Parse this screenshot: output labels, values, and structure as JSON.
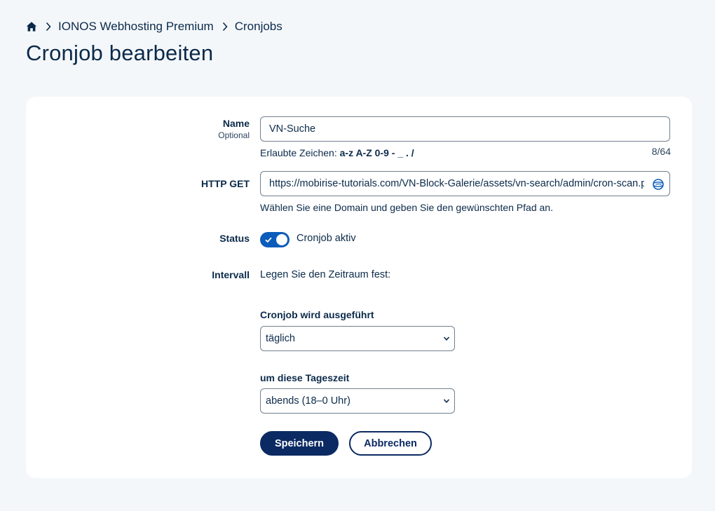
{
  "breadcrumb": {
    "items": [
      "IONOS Webhosting Premium",
      "Cronjobs"
    ]
  },
  "page": {
    "title": "Cronjob bearbeiten"
  },
  "form": {
    "name": {
      "label": "Name",
      "sublabel": "Optional",
      "value": "VN-Suche",
      "help_prefix": "Erlaubte Zeichen:",
      "help_chars": "a-z A-Z 0-9 - _ . /",
      "counter": "8/64"
    },
    "http_get": {
      "label": "HTTP GET",
      "value": "https://mobirise-tutorials.com/VN-Block-Galerie/assets/vn-search/admin/cron-scan.php",
      "help": "Wählen Sie eine Domain und geben Sie den gewünschten Pfad an."
    },
    "status": {
      "label": "Status",
      "toggle_label": "Cronjob aktiv",
      "enabled": true
    },
    "interval": {
      "label": "Intervall",
      "intro": "Legen Sie den Zeitraum fest:",
      "frequency_title": "Cronjob wird ausgeführt",
      "frequency_value": "täglich",
      "time_title": "um diese Tageszeit",
      "time_value": "abends (18–0 Uhr)"
    },
    "buttons": {
      "save": "Speichern",
      "cancel": "Abbrechen"
    }
  },
  "colors": {
    "background": "#f4f7fa",
    "text": "#0b2a4a",
    "toggle_on": "#0b5cbb",
    "primary_button": "#0b2a63"
  },
  "icons": {
    "home": "home-icon",
    "separator": "chevron-right-icon",
    "url_field": "globe-icon",
    "toggle": "check-icon",
    "select": "chevron-down-icon"
  }
}
